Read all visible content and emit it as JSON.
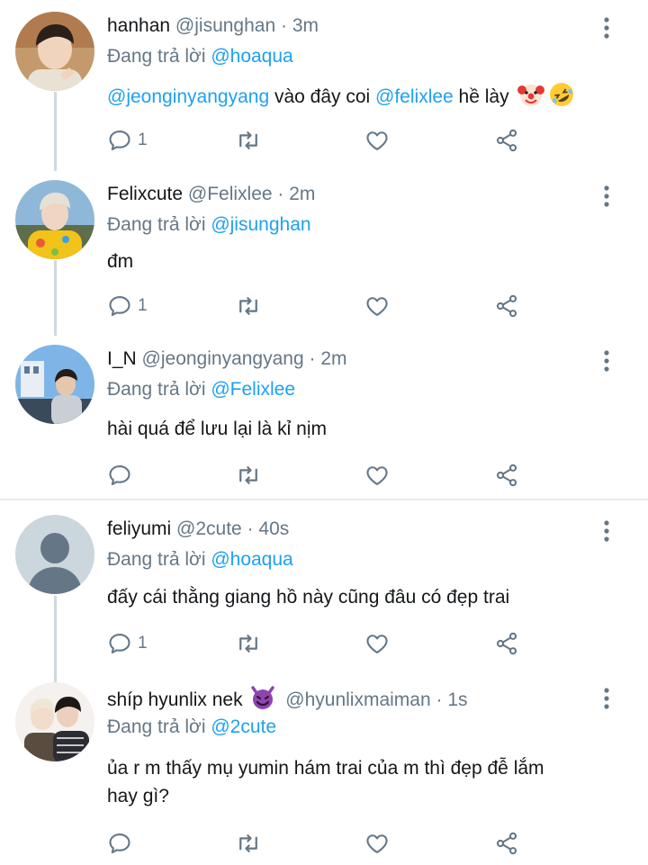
{
  "tweets": [
    {
      "name": "hanhan",
      "handle": "@jisunghan",
      "sep": "·",
      "time": "3m",
      "reply_prefix": "Đang trả lời ",
      "reply_to": "@hoaqua",
      "body_mention1": "@jeonginyangyang",
      "body_text1": " vào đây coi ",
      "body_mention2": "@felixlee",
      "body_text2": " hề lày",
      "emojis": [
        "clown-face-emoji",
        "rolling-laughing-emoji"
      ],
      "reply_count": "1"
    },
    {
      "name": "Felixcute",
      "handle": "@Felixlee",
      "sep": "·",
      "time": "2m",
      "reply_prefix": "Đang trả lời ",
      "reply_to": "@jisunghan",
      "body": "đm",
      "reply_count": "1"
    },
    {
      "name": "I_N",
      "handle": "@jeonginyangyang",
      "sep": "·",
      "time": "2m",
      "reply_prefix": "Đang trả lời ",
      "reply_to": "@Felixlee",
      "body": "hài quá để lưu lại là kỉ nịm",
      "reply_count": ""
    },
    {
      "name": "feliyumi",
      "handle": "@2cute",
      "sep": "·",
      "time": "40s",
      "reply_prefix": "Đang trả lời ",
      "reply_to": "@hoaqua",
      "body": "đấy cái thằng giang hồ này cũng đâu có đẹp trai",
      "reply_count": "1"
    },
    {
      "name": "shíp hyunlix nek",
      "name_emoji": "smiling-devil-emoji",
      "handle": "@hyunlixmaiman",
      "sep": "·",
      "time": "1s",
      "reply_prefix": "Đang trả lời ",
      "reply_to": "@2cute",
      "body_line1": "ủa r m thấy mụ yumin hám trai của m thì đẹp đễ lắm",
      "body_line2": "hay gì?",
      "reply_count": ""
    }
  ],
  "icons": {
    "reply": "reply-icon",
    "retweet": "retweet-icon",
    "like": "heart-icon",
    "share": "share-icon",
    "more": "more-vertical-icon"
  },
  "colors": {
    "text": "#14171a",
    "secondary": "#657786",
    "accent": "#1da1f2",
    "thread_line": "#cfd9de",
    "divider": "#e6ecf0"
  }
}
